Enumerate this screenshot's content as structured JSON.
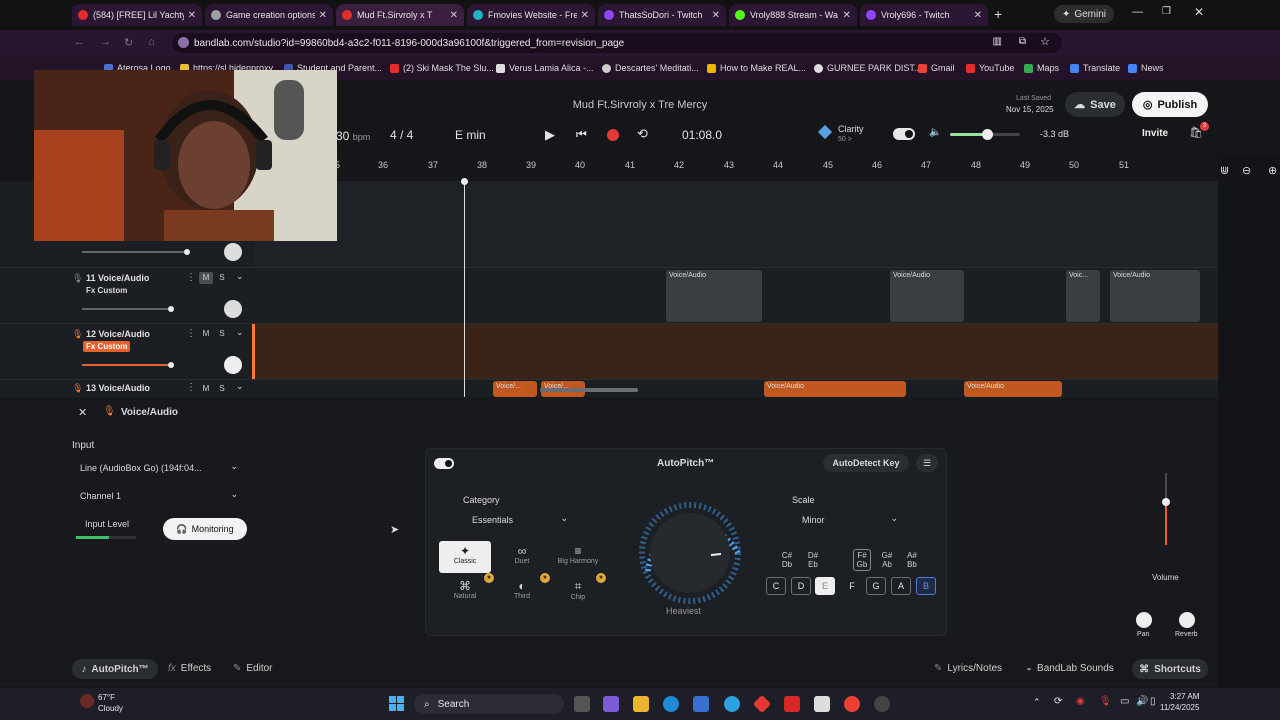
{
  "browser": {
    "tabs": [
      {
        "label": "(584) [FREE] Lil Yachty",
        "color": "#e52d27"
      },
      {
        "label": "Game creation options",
        "color": "#9aa0a6"
      },
      {
        "label": "Mud Ft.Sirvroly x T",
        "color": "#e52d27"
      },
      {
        "label": "Fmovies Website - Free",
        "color": "#1db4c4"
      },
      {
        "label": "ThatsSoDori - Twitch",
        "color": "#9146ff"
      },
      {
        "label": "Vroly888 Stream - Wa",
        "color": "#53fc18"
      },
      {
        "label": "Vroly696 - Twitch",
        "color": "#9146ff"
      }
    ],
    "gemini_label": "Gemini",
    "url": "bandlab.com/studio?id=99860bd4-a3c2-f011-8196-000d3a96100f&triggered_from=revision_page",
    "bookmarks": [
      "Aterosa Logo",
      "https://sl.hidenproxy...",
      "Student and Parent...",
      "(2) Ski Mask The Slu...",
      "Verus Lamia Alica -...",
      "Descartes' Meditati...",
      "How to Make REAL...",
      "GURNEE PARK DIST...",
      "Gmail",
      "YouTube",
      "Maps",
      "Translate",
      "News"
    ]
  },
  "header": {
    "project_title": "Mud Ft.Sirvroly x Tre Mercy",
    "bpm_value": "30",
    "bpm_unit": "bpm",
    "time_signature": "4 / 4",
    "key": "E min",
    "time": "01:08.0",
    "clarity_label": "Clarity",
    "clarity_value": "50 >",
    "volume_db": "-3.3 dB",
    "last_saved_label": "Last Saved",
    "last_saved_date": "Nov 15, 2025",
    "save_label": "Save",
    "publish_label": "Publish",
    "invite_label": "Invite",
    "cart_badge": "3"
  },
  "timeline": {
    "ticks": [
      "5",
      "36",
      "37",
      "38",
      "39",
      "40",
      "41",
      "42",
      "43",
      "44",
      "45",
      "46",
      "47",
      "48",
      "49",
      "50",
      "51"
    ]
  },
  "tracks": [
    {
      "name": "11 Voice/Audio",
      "fx": "Fx Custom",
      "m": "M",
      "s": "S"
    },
    {
      "name": "12 Voice/Audio",
      "fx": "Fx Custom",
      "m": "M",
      "s": "S"
    },
    {
      "name": "13 Voice/Audio",
      "m": "M",
      "s": "S"
    }
  ],
  "clips": {
    "voice_audio": "Voice/Audio",
    "voice_short": "Voice/...",
    "voice_tiny": "Voic..."
  },
  "panel": {
    "track_title": "Voice/Audio",
    "input_label": "Input",
    "input_device": "Line (AudioBox Go) (194f:04...",
    "channel": "Channel 1",
    "input_level_label": "Input Level",
    "monitoring_label": "Monitoring",
    "autopitch_title": "AutoPitch™",
    "autodetect_label": "AutoDetect Key",
    "category_label": "Category",
    "category_value": "Essentials",
    "presets": [
      "Classic",
      "Duet",
      "Big Harmony",
      "Natural",
      "Third",
      "Chip"
    ],
    "dial_label": "Heaviest",
    "scale_label": "Scale",
    "scale_value": "Minor",
    "sharps": [
      "C#\nDb",
      "D#\nEb",
      "F#\nGb",
      "G#\nAb",
      "A#\nBb"
    ],
    "naturals": [
      "C",
      "D",
      "E",
      "F",
      "G",
      "A",
      "B"
    ],
    "volume_label": "Volume",
    "pan_label": "Pan",
    "reverb_label": "Reverb"
  },
  "bottom_tabs": {
    "autopitch": "AutoPitch™",
    "effects": "Effects",
    "editor": "Editor",
    "lyrics": "Lyrics/Notes",
    "sounds": "BandLab Sounds",
    "shortcuts": "Shortcuts"
  },
  "taskbar": {
    "weather_temp": "67°F",
    "weather_desc": "Cloudy",
    "search_label": "Search",
    "time": "3:27 AM",
    "date": "11/24/2025"
  }
}
